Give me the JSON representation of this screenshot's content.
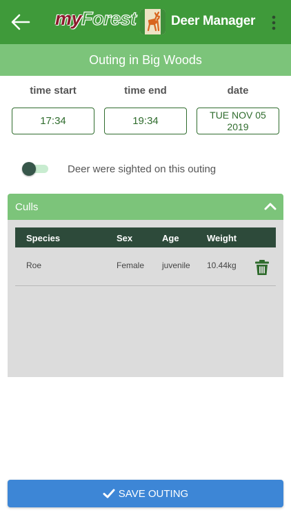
{
  "appbar": {
    "logo_my": "my",
    "logo_forest": "Forest",
    "title": "Deer Manager",
    "back_icon": "arrow-left-icon",
    "menu_icon": "more-vertical-icon"
  },
  "outing": {
    "title": "Outing in Big Woods"
  },
  "times": {
    "start_label": "time start",
    "end_label": "time end",
    "date_label": "date",
    "start_value": "17:34",
    "end_value": "19:34",
    "date_value": "TUE NOV 05 2019"
  },
  "sighting": {
    "label": "Deer were sighted on this outing",
    "enabled": false
  },
  "culls": {
    "title": "Culls",
    "expanded": true,
    "columns": [
      "Species",
      "Sex",
      "Age",
      "Weight"
    ],
    "rows": [
      {
        "species": "Roe",
        "sex": "Female",
        "age": "juvenile",
        "weight": "10.44kg"
      }
    ]
  },
  "save": {
    "label": "SAVE OUTING"
  },
  "colors": {
    "appbar": "#3f9a3a",
    "subheader": "#7cc47a",
    "table_header": "#2d4a3a",
    "button": "#3d86d6",
    "accent_dark": "#2e6b2c"
  }
}
